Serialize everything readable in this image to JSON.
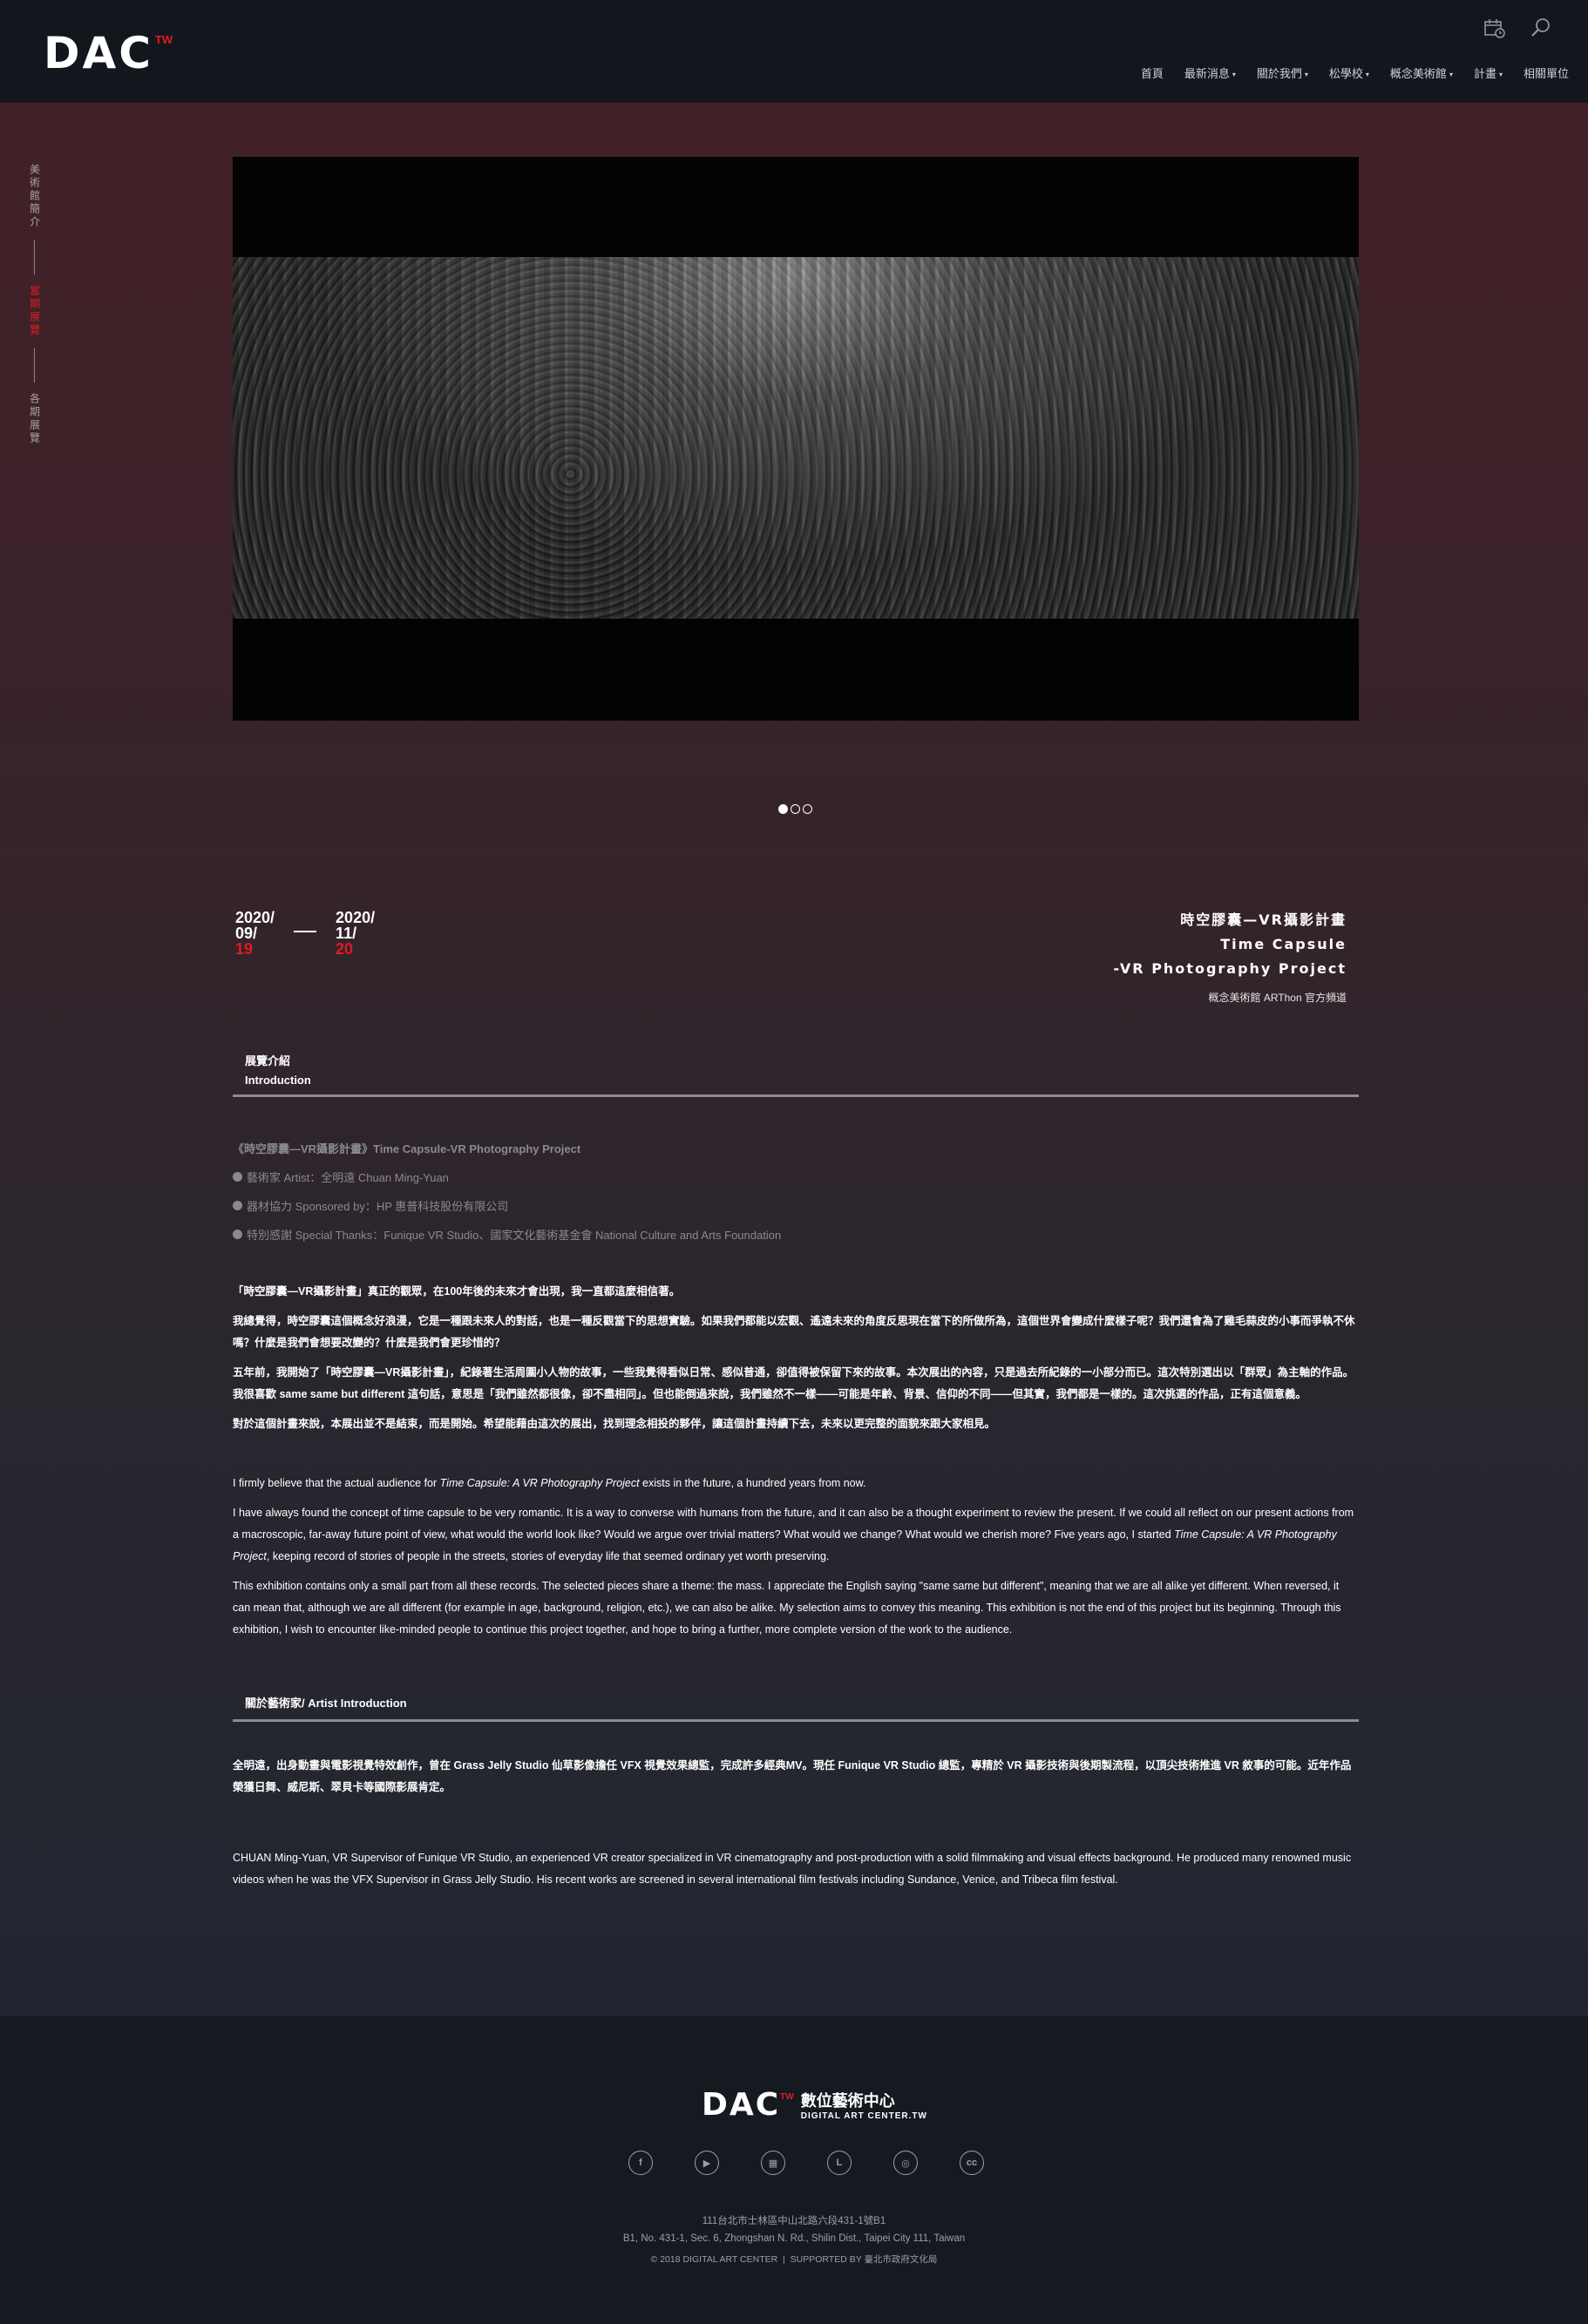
{
  "header": {
    "logo_text": "DAC",
    "logo_tw": "TW",
    "nav": [
      {
        "label": "首頁",
        "dropdown": false
      },
      {
        "label": "最新消息",
        "dropdown": true
      },
      {
        "label": "關於我們",
        "dropdown": true
      },
      {
        "label": "松學校",
        "dropdown": true
      },
      {
        "label": "概念美術館",
        "dropdown": true
      },
      {
        "label": "計畫",
        "dropdown": true
      },
      {
        "label": "相關單位",
        "dropdown": false
      }
    ],
    "icons": [
      "calendar-icon",
      "search-icon"
    ]
  },
  "side_nav": [
    {
      "label": "美術館簡介",
      "active": false
    },
    {
      "label": "當期展覽",
      "active": true
    },
    {
      "label": "各期展覽",
      "active": false
    }
  ],
  "carousel": {
    "slides": 3,
    "active_index": 0
  },
  "exhibition": {
    "start": {
      "year": "2020/",
      "month": "09/",
      "day": "19"
    },
    "end": {
      "year": "2020/",
      "month": "11/",
      "day": "20"
    },
    "title_lines": [
      "時空膠囊—VR攝影計畫",
      "Time Capsule",
      "-VR Photography Project"
    ],
    "source": "概念美術館 ARThon 官方頻道"
  },
  "intro_section": {
    "label_cn": "展覽介紹",
    "label_en": "Introduction"
  },
  "info": {
    "title": "《時空膠囊—VR攝影計畫》Time Capsule-VR Photography Project",
    "rows": [
      "藝術家 Artist：全明遠 Chuan Ming-Yuan",
      "器材協力 Sponsored by：HP 惠普科技股份有限公司",
      "特別感謝 Special Thanks：Funique VR Studio、國家文化藝術基金會 National Culture and Arts Foundation"
    ]
  },
  "intro_cn": [
    "「時空膠囊—VR攝影計畫」真正的觀眾，在100年後的未來才會出現，我一直都這麼相信著。",
    "我總覺得，時空膠囊這個概念好浪漫，它是一種跟未來人的對話，也是一種反觀當下的思想實驗。如果我們都能以宏觀、遙遠未來的角度反思現在當下的所做所為，這個世界會變成什麼樣子呢？我們還會為了雞毛蒜皮的小事而爭執不休嗎？什麼是我們會想要改變的？什麼是我們會更珍惜的？",
    "五年前，我開始了「時空膠囊—VR攝影計畫」，紀錄著生活周圍小人物的故事，一些我覺得看似日常、感似普通，卻值得被保留下來的故事。本次展出的內容，只是過去所紀錄的一小部分而已。這次特別選出以「群眾」為主軸的作品。我很喜歡 same same but different 這句話，意思是「我們雖然都很像，卻不盡相同」。但也能倒過來說，我們雖然不一樣——可能是年齡、背景、信仰的不同——但其實，我們都是一樣的。這次挑選的作品，正有這個意義。",
    "對於這個計畫來說，本展出並不是結束，而是開始。希望能藉由這次的展出，找到理念相投的夥伴，讓這個計畫持續下去，未來以更完整的面貌來跟大家相見。"
  ],
  "intro_en": {
    "p1_pre": "I firmly believe that the actual audience for ",
    "p1_em": "Time Capsule: A VR Photography Project",
    "p1_post": " exists in the future, a hundred years from now.",
    "p2_pre": "I have always found the concept of time capsule to be very romantic. It is a way to converse with humans from the future, and it can also be a thought experiment to review the present. If we could all reflect on our present actions from a macroscopic, far-away future point of view, what would the world look like? Would we argue over trivial matters? What would we change? What would we cherish more? Five years ago, I started ",
    "p2_em": "Time Capsule: A VR Photography Project",
    "p2_post": ", keeping record of stories of people in the streets, stories of everyday life that seemed ordinary yet worth preserving.",
    "p3": "This exhibition contains only a small part from all these records. The selected pieces share a theme: the mass. I appreciate the English saying \"same same but different\", meaning that we are all alike yet different. When reversed, it can mean that, although we are all different (for example in age, background, religion, etc.), we can also be alike. My selection aims to convey this meaning. This exhibition is not the end of this project but its beginning. Through this exhibition, I wish to encounter like-minded people to continue this project together, and hope to bring a further, more complete version of the work to the audience."
  },
  "artist_section": {
    "label": "關於藝術家/ Artist Introduction"
  },
  "artist_cn": "全明遠，出身動畫與電影視覺特效創作，曾在 Grass Jelly Studio 仙草影像擔任 VFX 視覺效果總監，完成許多經典MV。現任 Funique VR Studio 總監，專精於 VR 攝影技術與後期製流程，以頂尖技術推進 VR 敘事的可能。近年作品榮獲日舞、威尼斯、翠貝卡等國際影展肯定。",
  "artist_en": "CHUAN Ming-Yuan, VR Supervisor of Funique VR Studio, an experienced VR creator specialized in VR cinematography and post-production with a solid filmmaking and visual effects background. He produced many renowned music videos when he was the VFX Supervisor in Grass Jelly Studio. His recent works are screened in several international film festivals including Sundance, Venice, and Tribeca film festival.",
  "footer": {
    "logo_text": "DAC",
    "logo_tw": "TW",
    "name_cn": "數位藝術中心",
    "name_en": "DIGITAL ART CENTER.TW",
    "social": [
      {
        "icon": "facebook-icon",
        "glyph": "f"
      },
      {
        "icon": "youtube-icon",
        "glyph": "▶"
      },
      {
        "icon": "flickr-icon",
        "glyph": "▦"
      },
      {
        "icon": "line-icon",
        "glyph": "L"
      },
      {
        "icon": "instagram-icon",
        "glyph": "◎"
      },
      {
        "icon": "creative-commons-icon",
        "glyph": "cc"
      }
    ],
    "address_cn": "111台北市士林區中山北路六段431-1號B1",
    "address_en": "B1, No. 431-1, Sec. 6, Zhongshan N. Rd., Shilin Dist., Taipei City 111, Taiwan",
    "copyright": "© 2018 DIGITAL ART CENTER",
    "supported": "SUPPORTED BY",
    "supporter": "臺北市政府文化局"
  },
  "colors": {
    "accent": "#e11b23",
    "header_bg": "#12171d",
    "footer_bg": "#151a20"
  }
}
